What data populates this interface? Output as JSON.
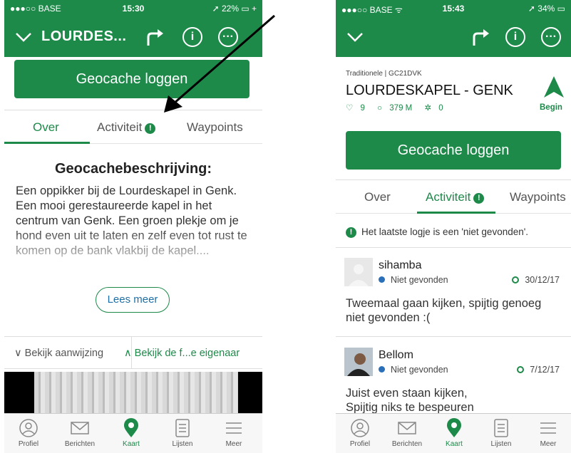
{
  "left": {
    "status": {
      "carrier": "●●●○○ BASE",
      "time": "15:30",
      "battery": "➚ 22% ▭ +"
    },
    "nav": {
      "title": "LOURDES..."
    },
    "log_button": "Geocache loggen",
    "tabs": [
      {
        "label": "Over"
      },
      {
        "label": "Activiteit"
      },
      {
        "label": "Waypoints"
      }
    ],
    "description": {
      "heading": "Geocachebeschrijving:",
      "text": "Een oppikker bij de Lourdeskapel in Genk. Een mooi gerestaureerde kapel in het centrum van Genk. Een groen plekje om je hond even uit te laten en zelf even tot rust te komen op de bank vlakbij de kapel...."
    },
    "lees_meer": "Lees meer",
    "hints": {
      "hint": "∨ Bekijk aanwijzing",
      "owner": "∧ Bekijk de f...e eigenaar"
    }
  },
  "right": {
    "status": {
      "carrier": "●●●○○ BASE ᯤ",
      "time": "15:43",
      "battery": "➚ 34% ▭"
    },
    "cache": {
      "meta": "Traditionele | GC21DVK",
      "name": "LOURDESKAPEL - GENK",
      "favorites": "9",
      "distance": "379 M",
      "trackables": "0",
      "begin": "Begin"
    },
    "log_button": "Geocache loggen",
    "tabs": [
      {
        "label": "Over"
      },
      {
        "label": "Activiteit"
      },
      {
        "label": "Waypoints"
      }
    ],
    "notice": "Het laatste logje is een 'niet gevonden'.",
    "logs": [
      {
        "user": "sihamba",
        "type": "Niet gevonden",
        "date": "30/12/17",
        "text": "Tweemaal gaan kijken, spijtig genoeg niet gevonden :("
      },
      {
        "user": "Bellom",
        "type": "Niet gevonden",
        "date": "7/12/17",
        "text": "Juist even staan kijken, Spijtig niks te bespeuren"
      }
    ]
  },
  "tabbar": [
    {
      "label": "Profiel",
      "icon": "person-icon"
    },
    {
      "label": "Berichten",
      "icon": "envelope-icon"
    },
    {
      "label": "Kaart",
      "icon": "map-pin-icon"
    },
    {
      "label": "Lijsten",
      "icon": "list-icon"
    },
    {
      "label": "Meer",
      "icon": "menu-icon"
    }
  ],
  "colors": {
    "brand_green": "#1d8a4a",
    "link_blue": "#1d6fa8",
    "status_blue": "#2a6fb8"
  }
}
